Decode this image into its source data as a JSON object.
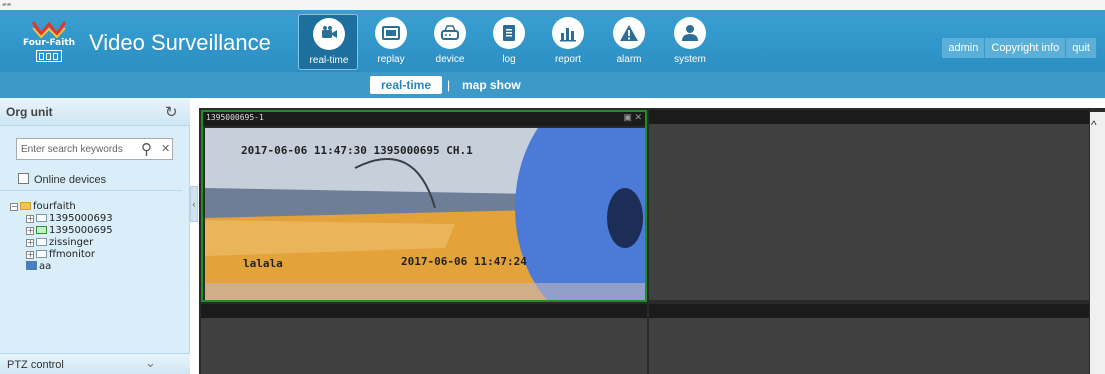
{
  "header": {
    "brand_logo_text": "Four-Faith",
    "app_title": "Video Surveillance",
    "nav": [
      {
        "label": "real-time",
        "icon": "camera-icon",
        "active": true
      },
      {
        "label": "replay",
        "icon": "film-icon",
        "active": false
      },
      {
        "label": "device",
        "icon": "router-icon",
        "active": false
      },
      {
        "label": "log",
        "icon": "document-icon",
        "active": false
      },
      {
        "label": "report",
        "icon": "bar-chart-icon",
        "active": false
      },
      {
        "label": "alarm",
        "icon": "warning-icon",
        "active": false
      },
      {
        "label": "system",
        "icon": "user-icon",
        "active": false
      }
    ],
    "buttons": {
      "admin": "admin",
      "copyright": "Copyright info",
      "quit": "quit"
    }
  },
  "subnav": {
    "realtime": "real-time",
    "separator": "|",
    "mapshow": "map show"
  },
  "sidebar": {
    "title": "Org unit",
    "search_placeholder": "Enter search keywords",
    "online_label": "Online devices",
    "tree": {
      "root": "fourfaith",
      "devices": [
        {
          "label": "1395000693",
          "online": false
        },
        {
          "label": "1395000695",
          "online": true
        },
        {
          "label": "zissinger",
          "online": false
        },
        {
          "label": "ffmonitor",
          "online": false
        }
      ],
      "group": "aa"
    },
    "ptz_label": "PTZ control"
  },
  "video": {
    "active_channel": "1395000695-1",
    "osd_top": "2017-06-06 11:47:30 1395000695 CH.1",
    "osd_bottom_left": "lalala",
    "osd_bottom_right": "2017-06-06 11:47:24"
  },
  "colors": {
    "header_blue": "#2b8fc4",
    "active_border": "#1e8f22",
    "sidebar_bg": "#d9eef9"
  }
}
